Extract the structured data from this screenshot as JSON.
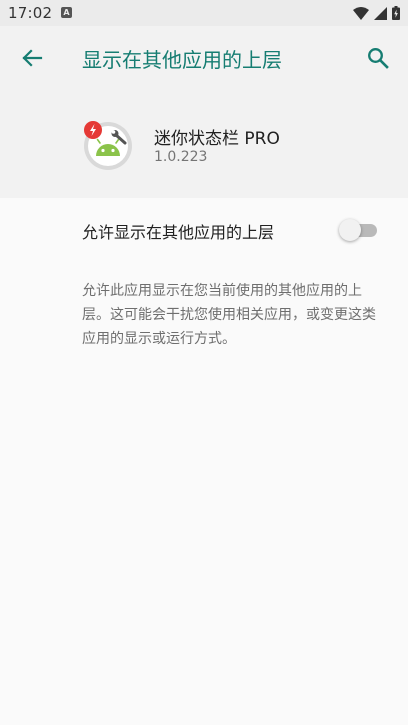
{
  "status_bar": {
    "time": "17:02",
    "notification_letter": "A"
  },
  "toolbar": {
    "title": "显示在其他应用的上层",
    "back_icon": "arrow-back-icon",
    "search_icon": "search-icon"
  },
  "app": {
    "name": "迷你状态栏 PRO",
    "version": "1.0.223"
  },
  "setting": {
    "label": "允许显示在其他应用的上层",
    "enabled": false
  },
  "description": "允许此应用显示在您当前使用的其他应用的上层。这可能会干扰您使用相关应用，或变更这类应用的显示或运行方式。",
  "colors": {
    "accent": "#167d72",
    "header_bg": "#f2f2f2",
    "status_bar_bg": "#ebebeb"
  }
}
